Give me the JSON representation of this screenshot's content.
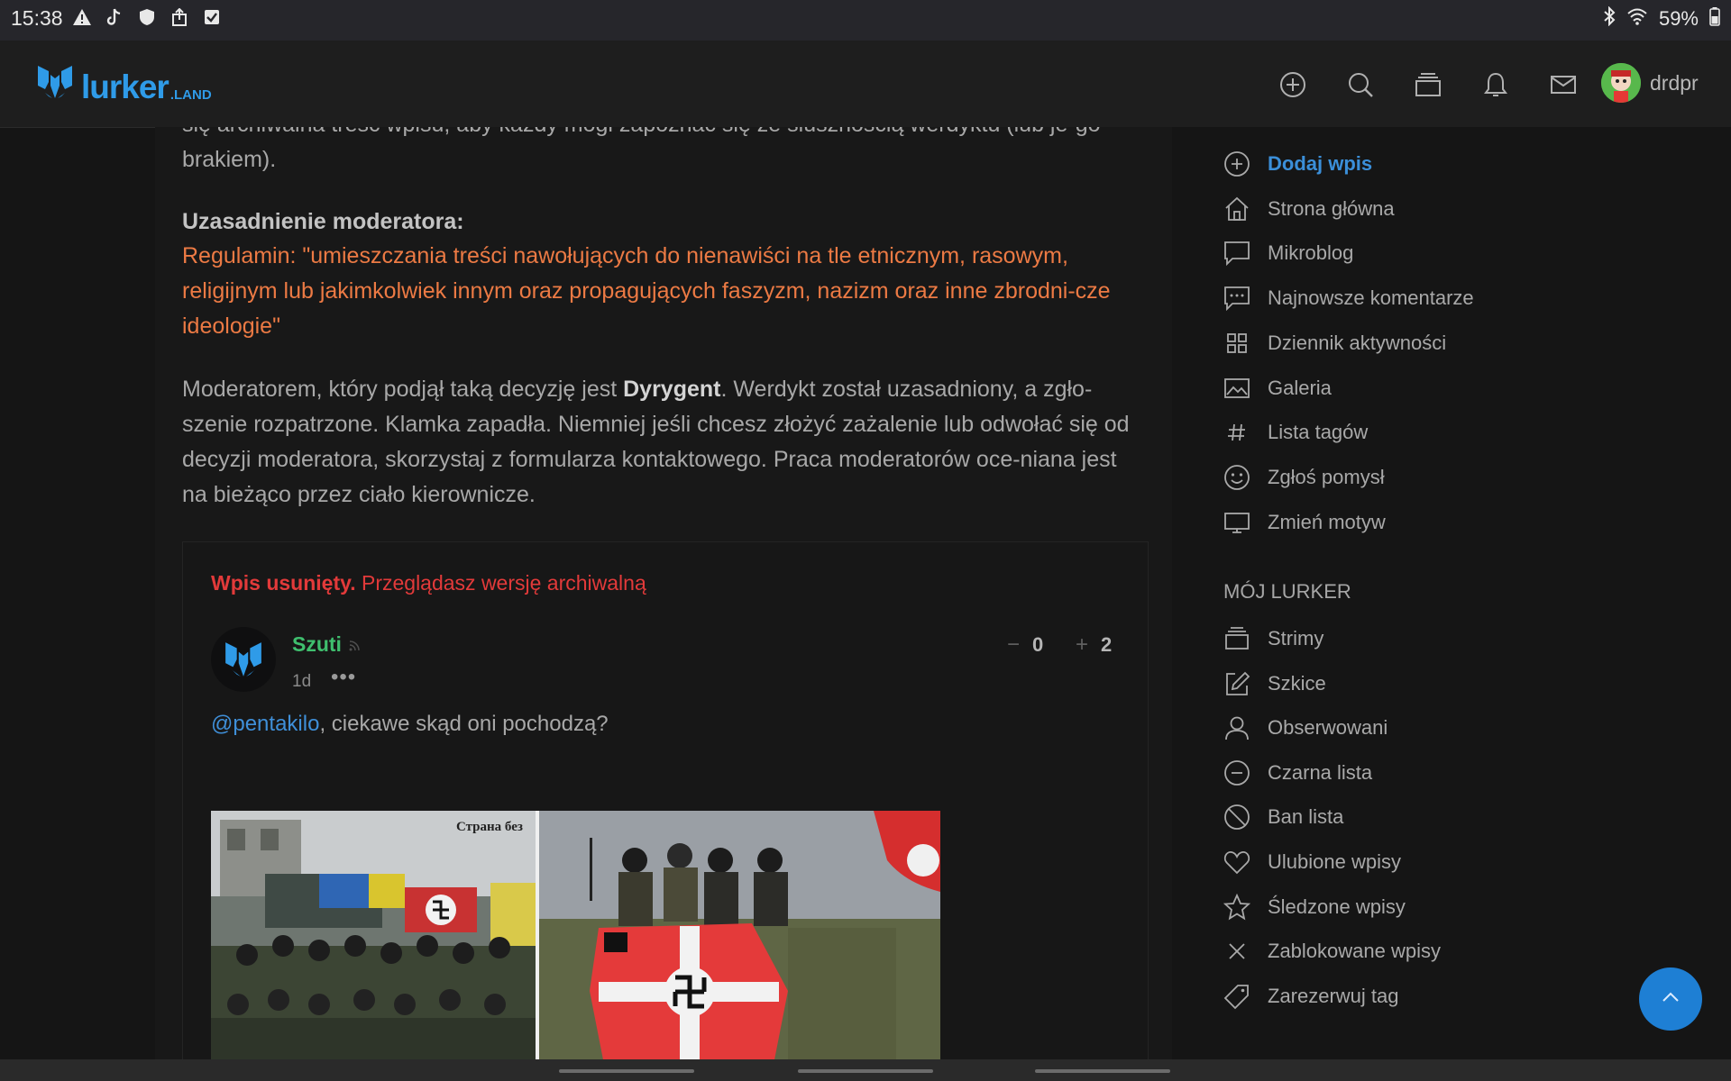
{
  "status_bar": {
    "time": "15:38",
    "battery": "59%",
    "left_icons": [
      "warning-icon",
      "tiktok-icon",
      "shield-icon",
      "share-icon",
      "checkbox-icon"
    ],
    "right_icons": [
      "bluetooth-icon",
      "wifi-icon",
      "battery-icon"
    ]
  },
  "header": {
    "logo_text": "lurker",
    "logo_suffix": ".LAND",
    "icons": [
      "add-icon",
      "search-icon",
      "streams-icon",
      "notifications-icon",
      "messages-icon"
    ],
    "username": "drdpr"
  },
  "main": {
    "cut_text": "się archiwalna treść wpisu, aby każdy mógł zapoznać się ze słusznością werdyktu (lub je-go brakiem).",
    "moderator_label": "Uzasadnienie moderatora:",
    "regulation_text": "Regulamin: \"umieszczania treści nawołujących do nienawiści na tle etnicznym, rasowym, religijnym lub jakimkolwiek innym oraz propagujących faszyzm, nazizm oraz inne zbrodni-cze ideologie\"",
    "decision_pre": "Moderatorem, który podjął taką decyzję jest ",
    "moderator_name": "Dyrygent",
    "decision_post": ". Werdykt został uzasadniony, a zgło-szenie rozpatrzone. Klamka zapadła. Niemniej jeśli chcesz złożyć zażalenie lub odwołać się od decyzji moderatora, skorzystaj z formularza kontaktowego. Praca moderatorów oce-niana jest na bieżąco przez ciało kierownicze."
  },
  "post": {
    "deleted_bold": "Wpis usunięty.",
    "deleted_rest": " Przeglądasz wersję archiwalną",
    "author": "Szuti",
    "time": "1d",
    "more": "•••",
    "minus_sign": "−",
    "minus_count": "0",
    "plus_sign": "+",
    "plus_count": "2",
    "mention": "@pentakilo",
    "text": ", ciekawe skąd oni pochodzą?",
    "image_caption": "Страна без"
  },
  "sidebar": {
    "items": [
      {
        "label": "Dodaj wpis",
        "icon": "plus-circle-icon",
        "active": true
      },
      {
        "label": "Strona główna",
        "icon": "home-icon"
      },
      {
        "label": "Mikroblog",
        "icon": "speech-bubble-icon"
      },
      {
        "label": "Najnowsze komentarze",
        "icon": "comments-icon"
      },
      {
        "label": "Dziennik aktywności",
        "icon": "grid-icon"
      },
      {
        "label": "Galeria",
        "icon": "image-icon"
      },
      {
        "label": "Lista tagów",
        "icon": "hash-icon"
      },
      {
        "label": "Zgłoś pomysł",
        "icon": "smile-icon"
      },
      {
        "label": "Zmień motyw",
        "icon": "monitor-icon"
      }
    ],
    "section_title": "MÓJ LURKER",
    "my_items": [
      {
        "label": "Strimy",
        "icon": "streams-icon"
      },
      {
        "label": "Szkice",
        "icon": "edit-icon"
      },
      {
        "label": "Obserwowani",
        "icon": "user-icon"
      },
      {
        "label": "Czarna lista",
        "icon": "minus-circle-icon"
      },
      {
        "label": "Ban lista",
        "icon": "ban-icon"
      },
      {
        "label": "Ulubione wpisy",
        "icon": "heart-icon"
      },
      {
        "label": "Śledzone wpisy",
        "icon": "star-icon"
      },
      {
        "label": "Zablokowane wpisy",
        "icon": "close-icon"
      },
      {
        "label": "Zarezerwuj tag",
        "icon": "tag-icon"
      }
    ]
  },
  "colors": {
    "accent": "#2f9be8",
    "regulation": "#ec7a44",
    "deleted": "#e23a3a",
    "author": "#3fbf6e",
    "scroll_button": "#1e7fd4"
  }
}
